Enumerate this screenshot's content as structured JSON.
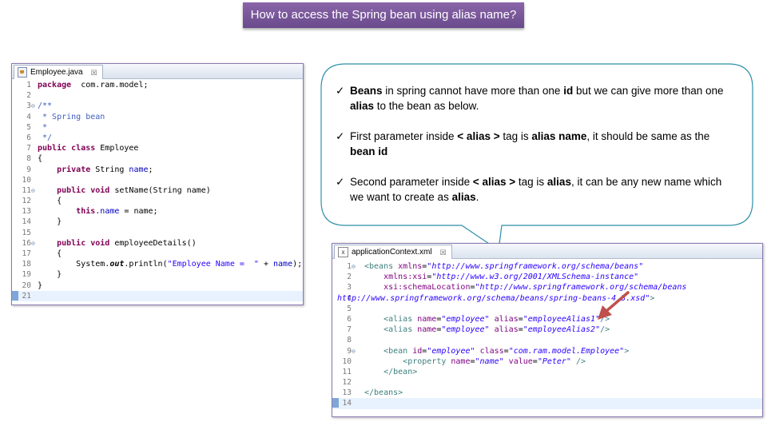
{
  "banner": {
    "title": "How to access the Spring bean using alias name?"
  },
  "java_editor": {
    "tab": {
      "label": "Employee.java",
      "close": "☒"
    },
    "lines": [
      {
        "n": "1",
        "segs": [
          [
            "kw",
            "package"
          ],
          [
            "",
            "  com.ram.model;"
          ]
        ]
      },
      {
        "n": "2",
        "segs": []
      },
      {
        "n": "3",
        "segs": [
          [
            "doc",
            "/**"
          ]
        ],
        "fold": true
      },
      {
        "n": "4",
        "segs": [
          [
            "doc",
            " * Spring bean"
          ]
        ]
      },
      {
        "n": "5",
        "segs": [
          [
            "doc",
            " *"
          ]
        ]
      },
      {
        "n": "6",
        "segs": [
          [
            "doc",
            " */"
          ]
        ]
      },
      {
        "n": "7",
        "segs": [
          [
            "kw",
            "public"
          ],
          [
            "",
            " "
          ],
          [
            "kw",
            "class"
          ],
          [
            "",
            " Employee"
          ]
        ]
      },
      {
        "n": "8",
        "segs": [
          [
            "",
            "{"
          ]
        ]
      },
      {
        "n": "9",
        "segs": [
          [
            "",
            "    "
          ],
          [
            "kw",
            "private"
          ],
          [
            "",
            " String "
          ],
          [
            "fld",
            "name"
          ],
          [
            "",
            ";"
          ]
        ]
      },
      {
        "n": "10",
        "segs": []
      },
      {
        "n": "11",
        "segs": [
          [
            "",
            "    "
          ],
          [
            "kw",
            "public"
          ],
          [
            "",
            " "
          ],
          [
            "kw",
            "void"
          ],
          [
            "",
            " setName(String name)"
          ]
        ],
        "fold": true
      },
      {
        "n": "12",
        "segs": [
          [
            "",
            "    {"
          ]
        ]
      },
      {
        "n": "13",
        "segs": [
          [
            "",
            "        "
          ],
          [
            "kw",
            "this"
          ],
          [
            "",
            "."
          ],
          [
            "fld",
            "name"
          ],
          [
            "",
            " = name;"
          ]
        ]
      },
      {
        "n": "14",
        "segs": [
          [
            "",
            "    }"
          ]
        ]
      },
      {
        "n": "15",
        "segs": []
      },
      {
        "n": "16",
        "segs": [
          [
            "",
            "    "
          ],
          [
            "kw",
            "public"
          ],
          [
            "",
            " "
          ],
          [
            "kw",
            "void"
          ],
          [
            "",
            " employeeDetails()"
          ]
        ],
        "fold": true
      },
      {
        "n": "17",
        "segs": [
          [
            "",
            "    {"
          ]
        ]
      },
      {
        "n": "18",
        "segs": [
          [
            "",
            "        System."
          ],
          [
            "sm",
            "out"
          ],
          [
            "",
            ".println("
          ],
          [
            "str",
            "\"Employee Name =  \""
          ],
          [
            "",
            " + "
          ],
          [
            "fld",
            "name"
          ],
          [
            "",
            ");"
          ]
        ]
      },
      {
        "n": "19",
        "segs": [
          [
            "",
            "    }"
          ]
        ]
      },
      {
        "n": "20",
        "segs": [
          [
            "",
            "}"
          ]
        ]
      },
      {
        "n": "21",
        "segs": [],
        "active": true
      }
    ]
  },
  "callout": {
    "points": [
      {
        "segs": [
          [
            "b",
            "Beans"
          ],
          [
            "",
            " in spring cannot have more than one "
          ],
          [
            "b",
            "id"
          ],
          [
            "",
            " but we can give more than one "
          ],
          [
            "b",
            "alias"
          ],
          [
            "",
            " to the bean as below."
          ]
        ]
      },
      {
        "segs": [
          [
            "",
            "First parameter inside "
          ],
          [
            "b",
            "< alias >"
          ],
          [
            "",
            " tag is "
          ],
          [
            "b",
            "alias name"
          ],
          [
            "",
            ", it should be same as the "
          ],
          [
            "b",
            "bean id"
          ]
        ]
      },
      {
        "segs": [
          [
            "",
            "Second parameter inside "
          ],
          [
            "b",
            "< alias >"
          ],
          [
            "",
            " tag is "
          ],
          [
            "b",
            "alias"
          ],
          [
            "",
            ", it can be any new name which we want to create as "
          ],
          [
            "b",
            "alias"
          ],
          [
            "",
            "."
          ]
        ]
      }
    ],
    "check_glyph": "✓"
  },
  "xml_editor": {
    "tab": {
      "label": "applicationContext.xml",
      "close": "☒",
      "icon": "x"
    },
    "lines": [
      {
        "n": "1",
        "segs": [
          [
            "xtag",
            "<beans"
          ],
          [
            "",
            " "
          ],
          [
            "xattr",
            "xmlns"
          ],
          [
            "",
            "="
          ],
          [
            "xval",
            "\"http://www.springframework.org/schema/beans\""
          ]
        ],
        "fold": true
      },
      {
        "n": "2",
        "segs": [
          [
            "",
            "    "
          ],
          [
            "xattr",
            "xmlns:xsi"
          ],
          [
            "",
            "="
          ],
          [
            "xval",
            "\"http://www.w3.org/2001/XMLSchema-instance\""
          ]
        ]
      },
      {
        "n": "3",
        "segs": [
          [
            "",
            "    "
          ],
          [
            "xattr",
            "xsi:schemaLocation"
          ],
          [
            "",
            "="
          ],
          [
            "xval",
            "\"http://www.springframework.org/schema/beans"
          ]
        ]
      },
      {
        "n": "4",
        "segs": [
          [
            "xval",
            "http://www.springframework.org/schema/beans/spring-beans-4.3.xsd\""
          ],
          [
            "xtag",
            ">"
          ]
        ],
        "wrap": true
      },
      {
        "n": "5",
        "segs": []
      },
      {
        "n": "6",
        "segs": [
          [
            "",
            "    "
          ],
          [
            "xtag",
            "<alias"
          ],
          [
            "",
            " "
          ],
          [
            "xattr",
            "name"
          ],
          [
            "",
            "="
          ],
          [
            "xval",
            "\"employee\""
          ],
          [
            "",
            " "
          ],
          [
            "xattr",
            "alias"
          ],
          [
            "",
            "="
          ],
          [
            "xval",
            "\"employeeAlias1\""
          ],
          [
            "xtag",
            "/>"
          ]
        ]
      },
      {
        "n": "7",
        "segs": [
          [
            "",
            "    "
          ],
          [
            "xtag",
            "<alias"
          ],
          [
            "",
            " "
          ],
          [
            "xattr",
            "name"
          ],
          [
            "",
            "="
          ],
          [
            "xval",
            "\"employee\""
          ],
          [
            "",
            " "
          ],
          [
            "xattr",
            "alias"
          ],
          [
            "",
            "="
          ],
          [
            "xval",
            "\"employeeAlias2\""
          ],
          [
            "xtag",
            "/>"
          ]
        ]
      },
      {
        "n": "8",
        "segs": []
      },
      {
        "n": "9",
        "segs": [
          [
            "",
            "    "
          ],
          [
            "xtag",
            "<bean"
          ],
          [
            "",
            " "
          ],
          [
            "xattr",
            "id"
          ],
          [
            "",
            "="
          ],
          [
            "xval",
            "\"employee\""
          ],
          [
            "",
            " "
          ],
          [
            "xattr",
            "class"
          ],
          [
            "",
            "="
          ],
          [
            "xval",
            "\"com.ram.model.Employee\""
          ],
          [
            "xtag",
            ">"
          ]
        ],
        "fold": true
      },
      {
        "n": "10",
        "segs": [
          [
            "",
            "        "
          ],
          [
            "xtag",
            "<property"
          ],
          [
            "",
            " "
          ],
          [
            "xattr",
            "name"
          ],
          [
            "",
            "="
          ],
          [
            "xval",
            "\"name\""
          ],
          [
            "",
            " "
          ],
          [
            "xattr",
            "value"
          ],
          [
            "",
            "="
          ],
          [
            "xval",
            "\"Peter\""
          ],
          [
            "",
            " "
          ],
          [
            "xtag",
            "/>"
          ]
        ]
      },
      {
        "n": "11",
        "segs": [
          [
            "",
            "    "
          ],
          [
            "xtag",
            "</bean>"
          ]
        ]
      },
      {
        "n": "12",
        "segs": []
      },
      {
        "n": "13",
        "segs": [
          [
            "xtag",
            "</beans>"
          ]
        ]
      },
      {
        "n": "14",
        "segs": [],
        "active": true
      }
    ]
  },
  "colors": {
    "banner": "#7a58a0",
    "callout_border": "#2f8fa8",
    "arrow": "#c0504d"
  },
  "icons": {
    "fold": "fold-icon",
    "check": "check-icon",
    "arrow": "arrow-icon"
  }
}
